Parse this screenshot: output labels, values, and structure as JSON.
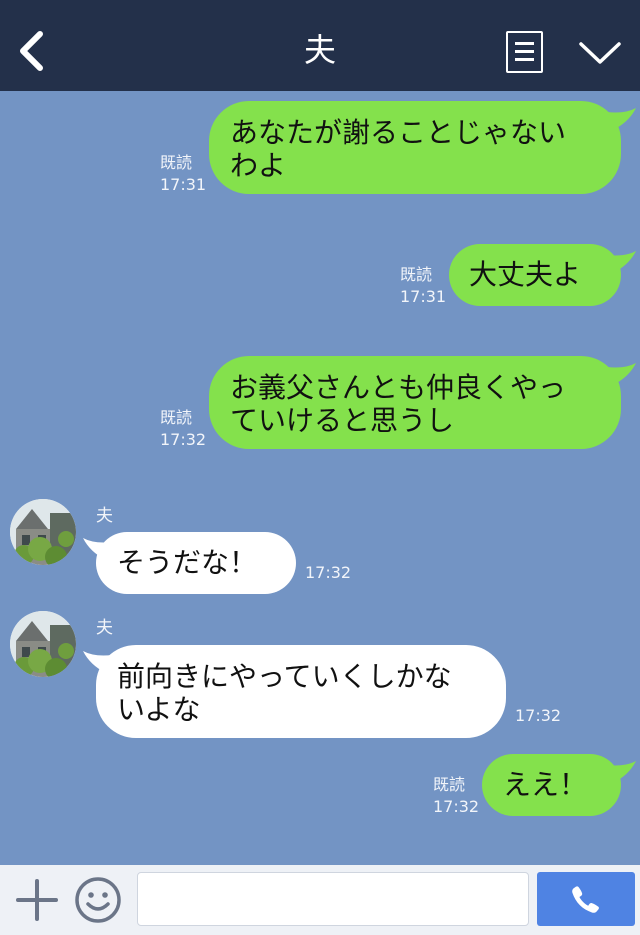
{
  "header": {
    "title": "夫"
  },
  "messages": [
    {
      "from": "me",
      "lines": [
        "あなたが謝ることじゃない",
        "わよ"
      ],
      "read": "既読",
      "time": "17:31"
    },
    {
      "from": "me",
      "lines": [
        "大丈夫よ"
      ],
      "read": "既読",
      "time": "17:31"
    },
    {
      "from": "me",
      "lines": [
        "お義父さんとも仲良くやっ",
        "ていけると思うし"
      ],
      "read": "既読",
      "time": "17:32"
    },
    {
      "from": "them",
      "sender": "夫",
      "lines": [
        "そうだな！"
      ],
      "time": "17:32"
    },
    {
      "from": "them",
      "sender": "夫",
      "lines": [
        "前向きにやっていくしかな",
        "いよな"
      ],
      "time": "17:32"
    },
    {
      "from": "me",
      "lines": [
        "ええ！"
      ],
      "read": "既読",
      "time": "17:32"
    }
  ],
  "colors": {
    "header_bg": "#23304a",
    "chat_bg": "#7394c4",
    "my_bubble": "#84e14c",
    "their_bubble": "#ffffff",
    "call_button": "#4f83e3"
  },
  "input": {
    "value": "",
    "placeholder": ""
  }
}
